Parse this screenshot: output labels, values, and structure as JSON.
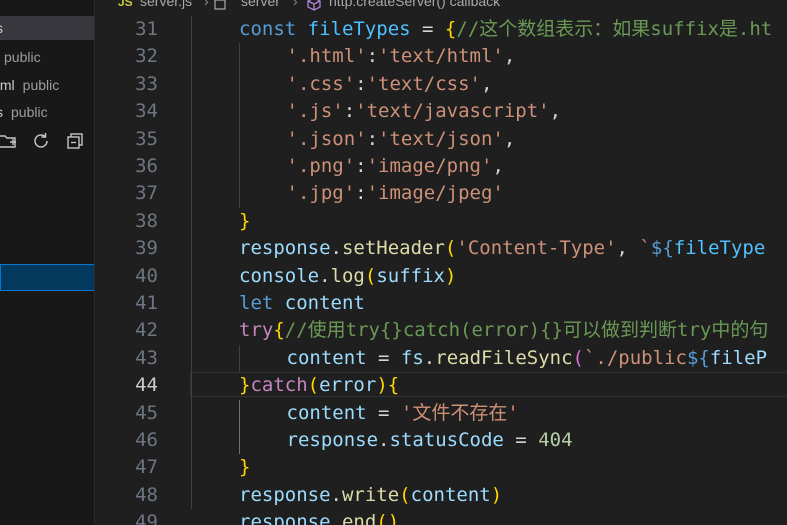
{
  "sidebar": {
    "rows": [
      {
        "name": "s",
        "folder": ""
      },
      {
        "name": "",
        "folder": "public"
      },
      {
        "name": "tml",
        "folder": "public"
      },
      {
        "name": "s",
        "folder": "public"
      },
      {
        "name": "l",
        "folder": ""
      }
    ],
    "toolbar_icons": [
      "new-folder-icon",
      "refresh-icon",
      "collapse-all-icon"
    ]
  },
  "breadcrumb": {
    "file_badge": "JS",
    "file": "server.js",
    "segment": "server",
    "symbol": "http.createServer() callback"
  },
  "editor": {
    "active_line": 44,
    "lines": [
      {
        "n": "31",
        "tokens": [
          [
            "kw",
            "const "
          ],
          [
            "const",
            "fileTypes"
          ],
          [
            "pun",
            " = "
          ],
          [
            "b1",
            "{"
          ],
          [
            "cm",
            "//这个数组表示：如果suffix是.ht"
          ]
        ]
      },
      {
        "n": "32",
        "tokens": [
          [
            "str",
            "'.html'"
          ],
          [
            "pun",
            ":"
          ],
          [
            "str",
            "'text/html'"
          ],
          [
            "pun",
            ","
          ]
        ]
      },
      {
        "n": "33",
        "tokens": [
          [
            "str",
            "'.css'"
          ],
          [
            "pun",
            ":"
          ],
          [
            "str",
            "'text/css'"
          ],
          [
            "pun",
            ","
          ]
        ]
      },
      {
        "n": "34",
        "tokens": [
          [
            "str",
            "'.js'"
          ],
          [
            "pun",
            ":"
          ],
          [
            "str",
            "'text/javascript'"
          ],
          [
            "pun",
            ","
          ]
        ]
      },
      {
        "n": "35",
        "tokens": [
          [
            "str",
            "'.json'"
          ],
          [
            "pun",
            ":"
          ],
          [
            "str",
            "'text/json'"
          ],
          [
            "pun",
            ","
          ]
        ]
      },
      {
        "n": "36",
        "tokens": [
          [
            "str",
            "'.png'"
          ],
          [
            "pun",
            ":"
          ],
          [
            "str",
            "'image/png'"
          ],
          [
            "pun",
            ","
          ]
        ]
      },
      {
        "n": "37",
        "tokens": [
          [
            "str",
            "'.jpg'"
          ],
          [
            "pun",
            ":"
          ],
          [
            "str",
            "'image/jpeg'"
          ]
        ]
      },
      {
        "n": "38",
        "tokens": [
          [
            "b1",
            "}"
          ]
        ]
      },
      {
        "n": "39",
        "tokens": [
          [
            "var",
            "response"
          ],
          [
            "pun",
            "."
          ],
          [
            "fn",
            "setHeader"
          ],
          [
            "b1",
            "("
          ],
          [
            "str",
            "'Content-Type'"
          ],
          [
            "pun",
            ", "
          ],
          [
            "str",
            "`"
          ],
          [
            "tpl",
            "${"
          ],
          [
            "const",
            "fileType"
          ]
        ]
      },
      {
        "n": "40",
        "tokens": [
          [
            "var",
            "console"
          ],
          [
            "pun",
            "."
          ],
          [
            "fn",
            "log"
          ],
          [
            "b1",
            "("
          ],
          [
            "var",
            "suffix"
          ],
          [
            "b1",
            ")"
          ]
        ]
      },
      {
        "n": "41",
        "tokens": [
          [
            "kw",
            "let "
          ],
          [
            "var",
            "content"
          ]
        ]
      },
      {
        "n": "42",
        "tokens": [
          [
            "ctl",
            "try"
          ],
          [
            "b1",
            "{"
          ],
          [
            "cm",
            "//使用try{}catch(error){}可以做到判断try中的句"
          ]
        ]
      },
      {
        "n": "43",
        "tokens": [
          [
            "var",
            "content"
          ],
          [
            "pun",
            " = "
          ],
          [
            "var",
            "fs"
          ],
          [
            "pun",
            "."
          ],
          [
            "fn",
            "readFileSync"
          ],
          [
            "b2",
            "("
          ],
          [
            "str",
            "`./public"
          ],
          [
            "tpl",
            "${"
          ],
          [
            "var",
            "fileP"
          ]
        ]
      },
      {
        "n": "44",
        "tokens": [
          [
            "b1",
            "}"
          ],
          [
            "ctl",
            "catch"
          ],
          [
            "b1",
            "("
          ],
          [
            "var",
            "error"
          ],
          [
            "b1",
            ")"
          ],
          [
            "b1",
            "{"
          ]
        ]
      },
      {
        "n": "45",
        "tokens": [
          [
            "var",
            "content"
          ],
          [
            "pun",
            " = "
          ],
          [
            "str",
            "'文件不存在'"
          ]
        ]
      },
      {
        "n": "46",
        "tokens": [
          [
            "var",
            "response"
          ],
          [
            "pun",
            "."
          ],
          [
            "var",
            "statusCode"
          ],
          [
            "pun",
            " = "
          ],
          [
            "num",
            "404"
          ]
        ]
      },
      {
        "n": "47",
        "tokens": [
          [
            "b1",
            "}"
          ]
        ]
      },
      {
        "n": "48",
        "tokens": [
          [
            "var",
            "response"
          ],
          [
            "pun",
            "."
          ],
          [
            "fn",
            "write"
          ],
          [
            "b1",
            "("
          ],
          [
            "var",
            "content"
          ],
          [
            "b1",
            ")"
          ]
        ]
      },
      {
        "n": "49",
        "tokens": [
          [
            "var",
            "response"
          ],
          [
            "pun",
            "."
          ],
          [
            "fn",
            "end"
          ],
          [
            "b1",
            "("
          ],
          [
            "b1",
            ")"
          ]
        ]
      }
    ]
  },
  "colors": {
    "editor_bg": "#1f1f1f",
    "sidebar_bg": "#181818",
    "selection_border": "#0078d4"
  }
}
